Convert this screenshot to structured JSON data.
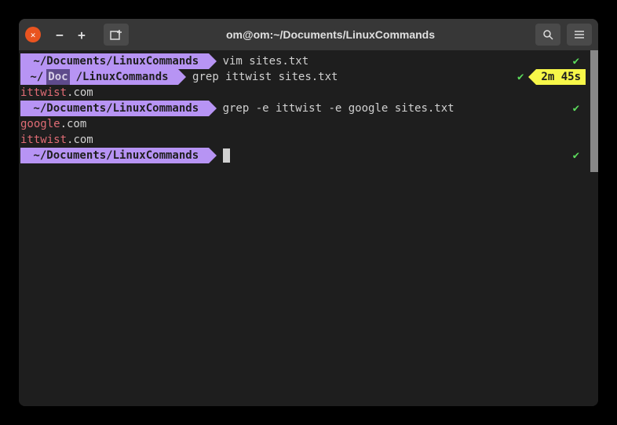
{
  "titlebar": {
    "title": "om@om:~/Documents/LinuxCommands"
  },
  "lines": {
    "l1": {
      "prompt": " ~/Documents/LinuxCommands ",
      "cmd": "vim sites.txt",
      "check": "✔"
    },
    "l2": {
      "prompt_a": " ~/",
      "prompt_b": "Doc",
      "prompt_c": "/LinuxCommands ",
      "cmd": "grep ittwist sites.txt",
      "check": "✔",
      "time": "2m 45s"
    },
    "l3": {
      "match": "ittwist",
      "rest": ".com"
    },
    "l4": {
      "prompt": " ~/Documents/LinuxCommands ",
      "cmd": "grep -e ittwist -e google sites.txt",
      "check": "✔"
    },
    "l5": {
      "match": "google",
      "rest": ".com"
    },
    "l6": {
      "match": "ittwist",
      "rest": ".com"
    },
    "l7": {
      "prompt": " ~/Documents/LinuxCommands ",
      "check": "✔"
    }
  }
}
